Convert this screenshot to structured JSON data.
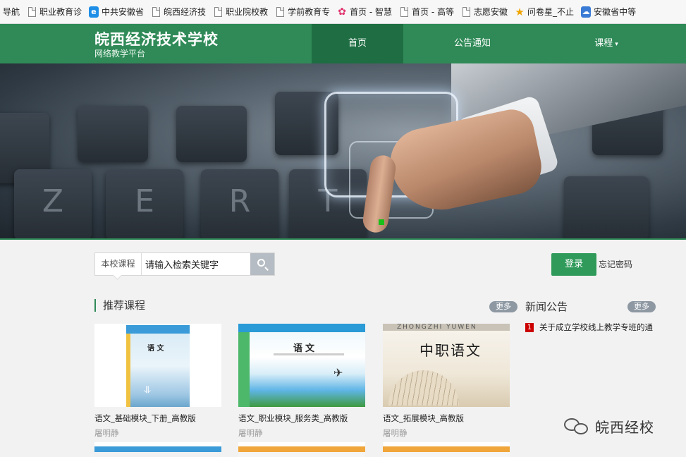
{
  "bookmarks": [
    {
      "label": "导航",
      "icon": "page-icon"
    },
    {
      "label": "职业教育诊",
      "icon": "page-icon"
    },
    {
      "label": "中共安徽省",
      "icon": "ie-icon"
    },
    {
      "label": "皖西经济技",
      "icon": "page-icon"
    },
    {
      "label": "职业院校教",
      "icon": "page-icon"
    },
    {
      "label": "学前教育专",
      "icon": "page-icon"
    },
    {
      "label": "首页 - 智慧",
      "icon": "flower-icon"
    },
    {
      "label": "首页 - 高等",
      "icon": "page-icon"
    },
    {
      "label": "志愿安徽",
      "icon": "page-icon"
    },
    {
      "label": "问卷星_不止",
      "icon": "star-icon"
    },
    {
      "label": "安徽省中等",
      "icon": "cloud-icon"
    }
  ],
  "header": {
    "site_title": "皖西经济技术学校",
    "site_subtitle": "网络教学平台",
    "nav": {
      "home": "首页",
      "notice": "公告通知",
      "course": "课程"
    },
    "brand_color": "#2f8a57"
  },
  "search": {
    "scope_label": "本校课程",
    "input_value": "请输入检索关键字"
  },
  "auth": {
    "login_label": "登录",
    "forgot_label": "忘记密码"
  },
  "recommended": {
    "title": "推荐课程",
    "more_label": "更多",
    "courses": [
      {
        "title": "语文_基础模块_下册_高教版",
        "author": "屠明静",
        "cover_text": "语 文"
      },
      {
        "title": "语文_职业模块_服务类_高教版",
        "author": "屠明静",
        "cover_text": "语文"
      },
      {
        "title": "语文_拓展模块_高教版",
        "author": "屠明静",
        "cover_text": "中职语文",
        "cover_pinyin": "ZHONGZHI YUWEN"
      }
    ]
  },
  "news": {
    "title": "新闻公告",
    "more_label": "更多",
    "items": [
      {
        "num": "1",
        "text": "关于成立学校线上教学专班的通"
      }
    ]
  },
  "watermark": {
    "text": "皖西经校"
  }
}
